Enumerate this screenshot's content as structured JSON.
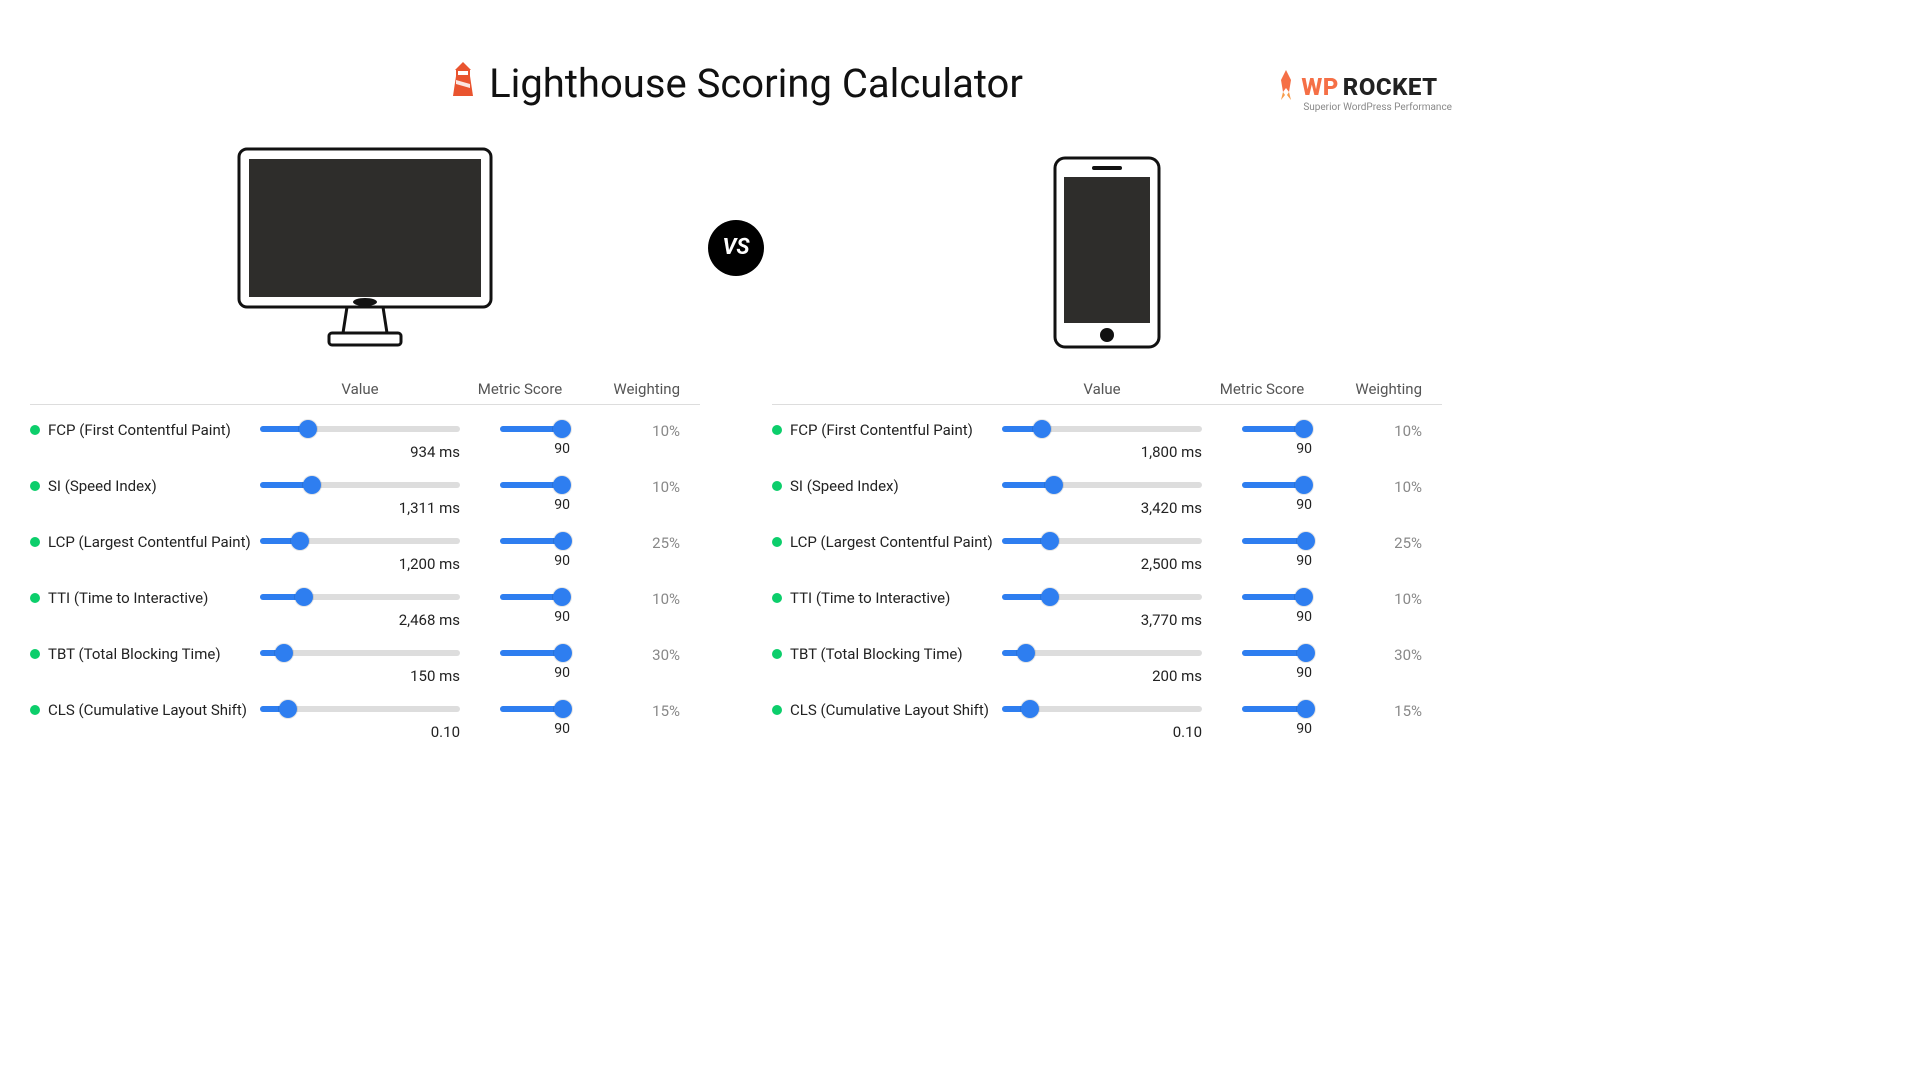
{
  "brand": {
    "wp": "WP",
    "rocket": "ROCKET",
    "tagline": "Superior WordPress Performance"
  },
  "title": "Lighthouse Scoring Calculator",
  "vs": "VS",
  "headers": {
    "value": "Value",
    "score": "Metric Score",
    "weight": "Weighting"
  },
  "desktop": {
    "metrics": [
      {
        "name": "FCP (First Contentful Paint)",
        "value": "934 ms",
        "vpos": 24,
        "score": "90",
        "spos": 88,
        "weight": "10%"
      },
      {
        "name": "SI (Speed Index)",
        "value": "1,311 ms",
        "vpos": 26,
        "score": "90",
        "spos": 88,
        "weight": "10%"
      },
      {
        "name": "LCP (Largest Contentful Paint)",
        "value": "1,200 ms",
        "vpos": 20,
        "score": "90",
        "spos": 90,
        "weight": "25%"
      },
      {
        "name": "TTI (Time to Interactive)",
        "value": "2,468 ms",
        "vpos": 22,
        "score": "90",
        "spos": 88,
        "weight": "10%"
      },
      {
        "name": "TBT (Total Blocking Time)",
        "value": "150 ms",
        "vpos": 12,
        "score": "90",
        "spos": 90,
        "weight": "30%"
      },
      {
        "name": "CLS (Cumulative Layout Shift)",
        "value": "0.10",
        "vpos": 14,
        "score": "90",
        "spos": 90,
        "weight": "15%"
      }
    ]
  },
  "mobile": {
    "metrics": [
      {
        "name": "FCP (First Contentful Paint)",
        "value": "1,800 ms",
        "vpos": 20,
        "score": "90",
        "spos": 88,
        "weight": "10%"
      },
      {
        "name": "SI (Speed Index)",
        "value": "3,420 ms",
        "vpos": 26,
        "score": "90",
        "spos": 88,
        "weight": "10%"
      },
      {
        "name": "LCP (Largest Contentful Paint)",
        "value": "2,500 ms",
        "vpos": 24,
        "score": "90",
        "spos": 92,
        "weight": "25%"
      },
      {
        "name": "TTI (Time to Interactive)",
        "value": "3,770 ms",
        "vpos": 24,
        "score": "90",
        "spos": 88,
        "weight": "10%"
      },
      {
        "name": "TBT (Total Blocking Time)",
        "value": "200 ms",
        "vpos": 12,
        "score": "90",
        "spos": 92,
        "weight": "30%"
      },
      {
        "name": "CLS (Cumulative Layout Shift)",
        "value": "0.10",
        "vpos": 14,
        "score": "90",
        "spos": 92,
        "weight": "15%"
      }
    ]
  }
}
